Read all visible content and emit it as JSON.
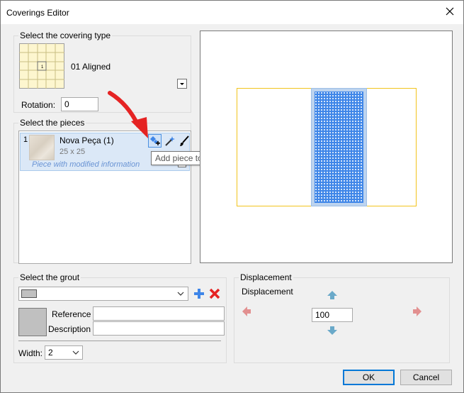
{
  "window": {
    "title": "Coverings Editor"
  },
  "covering_type": {
    "group_label": "Select the covering type",
    "preview_mark": "1",
    "selected_name": "01 Aligned",
    "rotation_label": "Rotation:",
    "rotation_value": "0"
  },
  "pieces": {
    "group_label": "Select the pieces",
    "items": [
      {
        "index": "1",
        "name": "Nova Peça (1)",
        "size": "25 x 25",
        "note": "Piece with modified information"
      }
    ],
    "tooltip": "Add piece to library"
  },
  "grout": {
    "group_label": "Select the grout",
    "reference_label": "Reference",
    "reference_value": "",
    "description_label": "Description",
    "description_value": "",
    "width_label": "Width:",
    "width_value": "2"
  },
  "displacement": {
    "group_label": "Displacement",
    "inner_label": "Displacement",
    "value": "100"
  },
  "footer": {
    "ok_label": "OK",
    "cancel_label": "Cancel"
  },
  "colors": {
    "tile_blue": "#3f86e8",
    "frame_yellow": "#f2c31c",
    "arrow_red": "#e52323",
    "accent": "#0078d7"
  }
}
